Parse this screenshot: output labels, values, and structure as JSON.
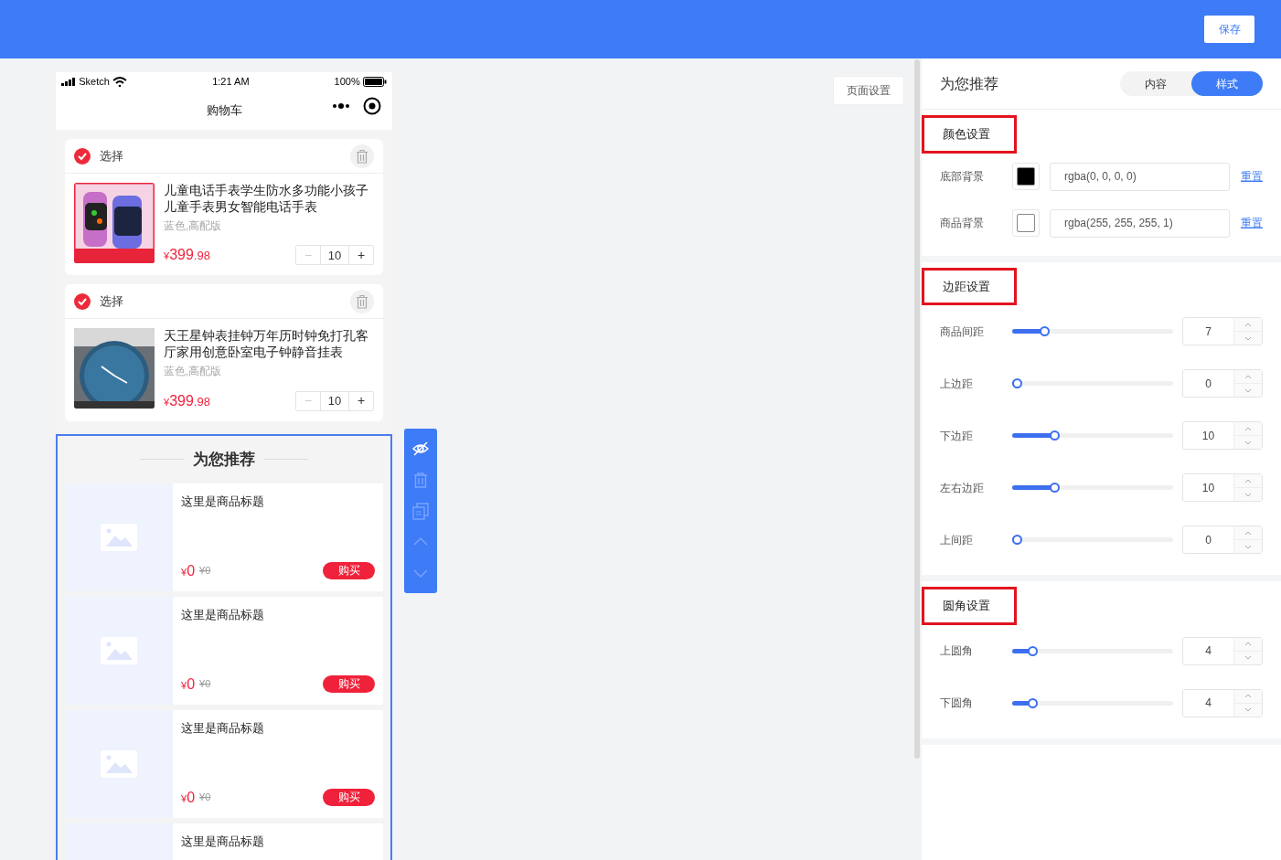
{
  "topbar": {
    "save_button": "保存"
  },
  "phone": {
    "status_bar": {
      "carrier": "Sketch",
      "time": "1:21 AM",
      "battery": "100%"
    },
    "nav_title": "购物车",
    "cart_items": [
      {
        "checked": true,
        "select_label": "选择",
        "title": "儿童电话手表学生防水多功能小孩子儿童手表男女智能电话手表",
        "spec": "蓝色,高配版",
        "price": {
          "currency": "¥",
          "integer": "399",
          "decimal": ".98"
        },
        "quantity": "10",
        "minus": "−",
        "plus": "+",
        "minus_disabled": true
      },
      {
        "checked": true,
        "select_label": "选择",
        "title": "天王星钟表挂钟万年历时钟免打孔客厅家用创意卧室电子钟静音挂表",
        "spec": "蓝色,高配版",
        "price": {
          "currency": "¥",
          "integer": "399",
          "decimal": ".98"
        },
        "quantity": "10",
        "minus": "−",
        "plus": "+",
        "minus_disabled": true
      }
    ],
    "recommend": {
      "selected": true,
      "title": "为您推荐",
      "items": [
        {
          "title": "这里是商品标题",
          "price": {
            "currency": "¥",
            "integer": "0"
          },
          "original_price": "¥0",
          "buy": "购买"
        },
        {
          "title": "这里是商品标题",
          "price": {
            "currency": "¥",
            "integer": "0"
          },
          "original_price": "¥0",
          "buy": "购买"
        },
        {
          "title": "这里是商品标题",
          "price": {
            "currency": "¥",
            "integer": "0"
          },
          "original_price": "¥0",
          "buy": "购买"
        },
        {
          "title": "这里是商品标题"
        }
      ]
    },
    "toolbar": [
      {
        "kind": "hide",
        "disabled": false
      },
      {
        "kind": "delete",
        "disabled": true
      },
      {
        "kind": "copy",
        "disabled": true
      },
      {
        "kind": "up",
        "disabled": true
      },
      {
        "kind": "down",
        "disabled": true
      }
    ]
  },
  "page_settings_button": "页面设置",
  "panel": {
    "title": "为您推荐",
    "tabs": [
      {
        "label": "内容",
        "selected": false
      },
      {
        "label": "样式",
        "selected": true
      }
    ],
    "sections": [
      {
        "title": "颜色设置",
        "highlighted": true,
        "rows": [
          {
            "kind": "color",
            "label": "底部背景",
            "color": "#000000",
            "value": "rgba(0, 0, 0, 0)",
            "reset": "重置"
          },
          {
            "kind": "color",
            "label": "商品背景",
            "color": "#ffffff",
            "value": "rgba(255, 255, 255, 1)",
            "reset": "重置"
          }
        ]
      },
      {
        "title": "边距设置",
        "highlighted": true,
        "rows": [
          {
            "kind": "slider",
            "label": "商品间距",
            "level": 0.18,
            "value": "7"
          },
          {
            "kind": "slider",
            "label": "上边距",
            "level": 0,
            "value": "0"
          },
          {
            "kind": "slider",
            "label": "下边距",
            "level": 0.25,
            "value": "10"
          },
          {
            "kind": "slider",
            "label": "左右边距",
            "level": 0.25,
            "value": "10"
          },
          {
            "kind": "slider",
            "label": "上间距",
            "level": 0,
            "value": "0"
          }
        ]
      },
      {
        "title": "圆角设置",
        "highlighted": true,
        "rows": [
          {
            "kind": "slider",
            "label": "上圆角",
            "level": 0.1,
            "value": "4"
          },
          {
            "kind": "slider",
            "label": "下圆角",
            "level": 0.1,
            "value": "4"
          }
        ]
      }
    ]
  }
}
